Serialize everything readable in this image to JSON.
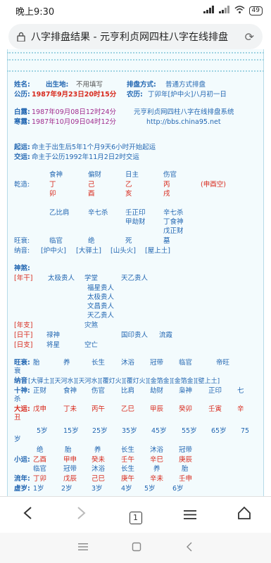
{
  "status": {
    "time": "晚上9:30",
    "battery": "49"
  },
  "address": {
    "title": "八字排盘结果 - 元亨利贞网四柱八字在线排盘"
  },
  "info": {
    "name_label": "姓名:",
    "birthplace_label": "出生地:",
    "birthplace": "不用填写",
    "method_label": "排盘方式:",
    "method": "普通方式排盘",
    "solar_label": "公历:",
    "solar": "1987年9月23日20时15分",
    "lunar_label": "农历:",
    "lunar": "丁卯年[炉中火]八月初一日",
    "bailu_label": "白露:",
    "bailu": "1987年09月08日12时24分",
    "hanlu_label": "寒露:",
    "hanlu": "1987年10月09日04时12分",
    "site_name": "元亨利贞网四柱八字在线排盘系统",
    "site_url": "http://bbs.china95.net",
    "qiyun_label": "起运:",
    "qiyun": "命主于出生后5年1个月9天6小时开始起运",
    "jiaoyun_label": "交运:",
    "jiaoyun": "命主于公历1992年11月2日2时交运"
  },
  "pillars": {
    "gods": [
      "食神",
      "偏财",
      "日主",
      "伤官"
    ],
    "qianzao_label": "乾造:",
    "stems": [
      "丁",
      "己",
      "乙",
      "丙"
    ],
    "branches": [
      "卯",
      "酉",
      "亥",
      "戌"
    ],
    "kongwang": "(申酉空)",
    "hidden": [
      [
        "乙比肩"
      ],
      [
        "辛七杀"
      ],
      [
        "壬正印",
        "甲劫财"
      ],
      [
        "辛七杀",
        "丁食神",
        "戊正财"
      ]
    ],
    "wangshuai_label": "旺衰:",
    "wangshuai": [
      "临官",
      "绝",
      "死",
      "墓"
    ],
    "nayin_label": "纳音:",
    "nayin": [
      "[炉中火]",
      "[大驿土]",
      "[山头火]",
      "[屋上土]"
    ]
  },
  "shensha": {
    "title": "神煞:",
    "year_stem_label": "[年干]",
    "year_stem_items": [
      "太极贵人",
      "学堂",
      "天乙贵人"
    ],
    "stack": [
      "福星贵人",
      "太极贵人",
      "文昌贵人",
      "天乙贵人"
    ],
    "year_branch_label": "[年支]",
    "year_branch_item": "灾煞",
    "day_stem_label": "[日干]",
    "day_stem_items": [
      "禄神",
      "国印贵人",
      "流霞"
    ],
    "day_branch_label": "[日支]",
    "day_branch_items": [
      "将星",
      "空亡"
    ]
  },
  "dayun": {
    "wangshuai_label": "旺衰:",
    "wangshuai": [
      "胎",
      "养",
      "长生",
      "沐浴",
      "冠带",
      "临官",
      "帝旺"
    ],
    "wangshuai_wrap": "衰",
    "nayin_label": "纳音",
    "nayin": "[大驿土][天河水][天河水][覆灯火][覆灯火][金箔金][金箔金][壁上土]",
    "shishen_label": "十神:",
    "shishen": [
      "正财",
      "食神",
      "伤官",
      "比肩",
      "劫财",
      "枭神",
      "正印",
      "七"
    ],
    "shishen_wrap": "杀",
    "dayun_label": "大运:",
    "dayun": [
      "戊申",
      "丁未",
      "丙午",
      "乙巳",
      "甲辰",
      "癸卯",
      "壬寅",
      "辛"
    ],
    "dayun_wrap": "丑",
    "ages": [
      "5岁",
      "15岁",
      "25岁",
      "35岁",
      "45岁",
      "55岁",
      "65岁",
      "75"
    ],
    "ages_wrap": "岁",
    "xiaoyun_top": [
      "绝",
      "胎",
      "养",
      "长生",
      "沐浴",
      "冠带"
    ],
    "xiaoyun_label": "小运:",
    "xiaoyun": [
      "乙酉",
      "甲申",
      "癸未",
      "壬午",
      "辛巳",
      "庚辰"
    ],
    "xiaoyun_bottom": [
      "临官",
      "冠带",
      "沐浴",
      "长生",
      "养",
      "胎"
    ],
    "liunian_label": "流年:",
    "liunian": [
      "丁卯",
      "戊辰",
      "己巳",
      "庚午",
      "辛未",
      "壬申"
    ],
    "xusui_label": "虚岁:",
    "xusui": [
      "1岁",
      "2岁",
      "3岁",
      "4岁",
      "5岁",
      "6岁"
    ]
  },
  "nav": {
    "tab_count": "1"
  }
}
